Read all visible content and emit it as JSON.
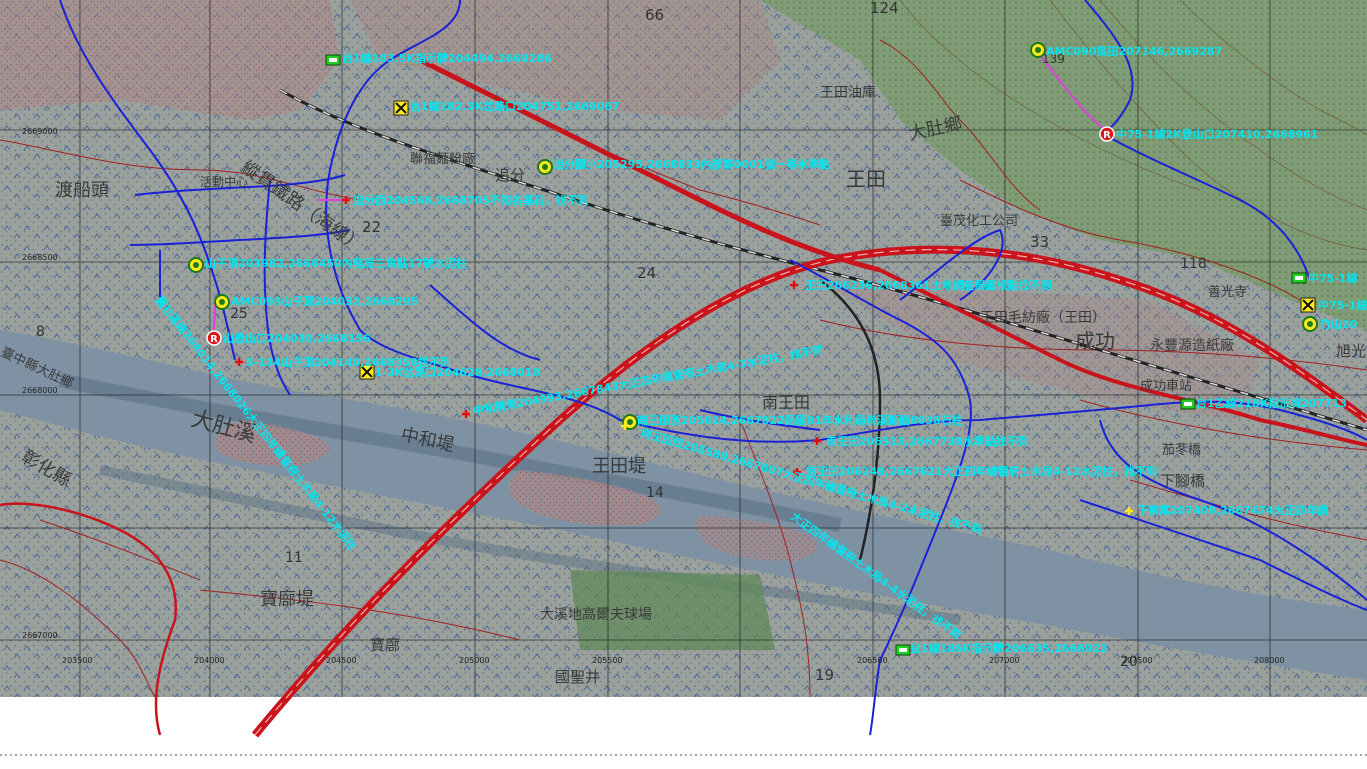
{
  "colors": {
    "land": "#9aa09c",
    "river": "#7e92a3",
    "hill_green": "#7f9c77",
    "route_blue": "#1a22d8",
    "rail_red": "#c8141a",
    "road_red": "#b52a2a",
    "label_cyan": "#00e5f0",
    "gps_line_magenta": "#e040e0",
    "marker_yellow": "#ffe81a",
    "marker_green": "#22cc22"
  },
  "place_names": [
    {
      "text": "渡船頭"
    },
    {
      "text": "活動中心"
    },
    {
      "text": "聯福麵粉廠"
    },
    {
      "text": "追分"
    },
    {
      "text": "王田"
    },
    {
      "text": "王田油庫"
    },
    {
      "text": "大肚鄉"
    },
    {
      "text": "臺茂化工公司"
    },
    {
      "text": "成功"
    },
    {
      "text": "永豐源造紙廠"
    },
    {
      "text": "成功車站"
    },
    {
      "text": "王田毛紡廠（王田）"
    },
    {
      "text": "南王田"
    },
    {
      "text": "王田堤"
    },
    {
      "text": "中和堤"
    },
    {
      "text": "寶廍堤"
    },
    {
      "text": "寶廍"
    },
    {
      "text": "國聖井"
    },
    {
      "text": "大溪地高爾夫球場"
    },
    {
      "text": "茄苳橋"
    },
    {
      "text": "下腳橋"
    },
    {
      "text": "善光寺"
    },
    {
      "text": "旭光"
    },
    {
      "text": "彰化縣"
    },
    {
      "text": "臺中縣大肚鄉"
    },
    {
      "text": "縱貫鐵路（海線）"
    },
    {
      "text": "大肚溪"
    }
  ],
  "contour_numbers": [
    {
      "text": "66"
    },
    {
      "text": "124"
    },
    {
      "text": "139"
    },
    {
      "text": "33"
    },
    {
      "text": "118"
    },
    {
      "text": "22"
    },
    {
      "text": "24"
    },
    {
      "text": "25"
    },
    {
      "text": "14"
    },
    {
      "text": "11"
    },
    {
      "text": "8"
    },
    {
      "text": "19"
    },
    {
      "text": "20"
    }
  ],
  "grid_labels": [
    {
      "text": "2669000"
    },
    {
      "text": "2668500"
    },
    {
      "text": "2668000"
    },
    {
      "text": "2667000"
    },
    {
      "text": "203500"
    },
    {
      "text": "204000"
    },
    {
      "text": "204500"
    },
    {
      "text": "205000"
    },
    {
      "text": "205500"
    },
    {
      "text": "206500"
    },
    {
      "text": "207000"
    },
    {
      "text": "207500"
    },
    {
      "text": "208000"
    }
  ],
  "waypoints": [
    {
      "id": "wp1",
      "marker": "mm-sign",
      "label": "台1線183.5K指示牌204494,2669286"
    },
    {
      "id": "wp2",
      "marker": "x-junction",
      "label": "台1線182.3K岔路口204751,2669067"
    },
    {
      "id": "wp3",
      "marker": "gps-target",
      "label": "追分國小205295,2668833內部第0001號一等水準點"
    },
    {
      "id": "wp4",
      "marker": "red-cross",
      "label": "追分西204546,2668705不知名基石，找不到"
    },
    {
      "id": "wp5",
      "marker": "gps-target",
      "label": "山子頂203982,2668450內務局三角點17號水泥柱"
    },
    {
      "id": "wp6",
      "marker": "gps-target",
      "label": "AMC093山子頂204032,2668295"
    },
    {
      "id": "wp7",
      "marker": "r-circle",
      "label": "山登山口204030,2668156"
    },
    {
      "id": "wp8",
      "marker": "red-cross",
      "label": "3-134山子頂204140,2668358找不到"
    },
    {
      "id": "wp9",
      "marker": "x-junction",
      "label": "1-3K岔路口204628,2668018"
    },
    {
      "id": "wp10",
      "marker": "red-cross",
      "label": "中和橋東204993,2667843大正四年總督府土木局4-3水泥柱，找不到"
    },
    {
      "id": "wp11",
      "marker": "gps-target",
      "label": "南王田西205614,2667822民國81年水利局烏溪斷面8038石柱"
    },
    {
      "id": "wp12",
      "marker": "red-cross",
      "label": "南王田206513,2667738水準點找不到"
    },
    {
      "id": "wp13",
      "marker": "red-cross",
      "label": "南王田206249,2667621大正四年總督府土木局4-12水泥柱，找不到"
    },
    {
      "id": "wp14",
      "marker": "red-cross",
      "label": "王田206236,2668361土地調查局圖根點找不到"
    },
    {
      "id": "wp15",
      "marker": "gps-target",
      "label": "AMC090吳田207146,2669287"
    },
    {
      "id": "wp16",
      "marker": "r-circle",
      "label": "中75-1線2K登山口207410,2668961"
    },
    {
      "id": "wp17",
      "marker": "mm-sign",
      "label": "中75-1線"
    },
    {
      "id": "wp18",
      "marker": "x-junction",
      "label": "中75-1線"
    },
    {
      "id": "wp19",
      "marker": "gps-target",
      "label": "竹山20"
    },
    {
      "id": "wp20",
      "marker": "mm-sign",
      "label": "台1乙線218K指示牌207713"
    },
    {
      "id": "wp21",
      "marker": "yellow-cross",
      "label": "下寮寓207409,2667474大正四年總"
    },
    {
      "id": "wp22",
      "marker": "mm-sign",
      "label": "台1線186K指示牌206635,2666922"
    },
    {
      "id": "wp23",
      "marker": "yellow-cross",
      "label": "南王田西205589,2667807大正四年總督府土木局4-2水泥柱，找不到"
    },
    {
      "id": "wp24",
      "marker": "none",
      "label": "舊社區南204014,2668026大正四年總督府土木局4-12水泥柱"
    },
    {
      "id": "wp25",
      "marker": "none",
      "label": "大正四年總督府土木局4-4水泥柱，找不到"
    }
  ]
}
